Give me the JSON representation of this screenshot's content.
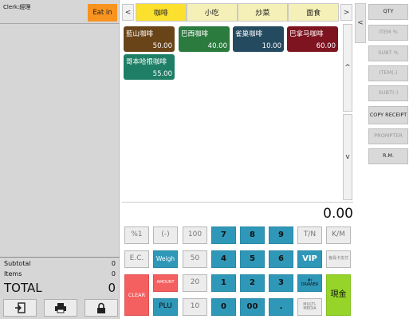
{
  "receipt": {
    "clerk_text": "Clerk:經理",
    "eat_in_label": "Eat in",
    "subtotal_label": "Subtotal",
    "subtotal_value": "0",
    "items_label": "Items",
    "items_value": "0",
    "total_label": "TOTAL",
    "total_value": "0"
  },
  "bottom_buttons": [
    {
      "icon": "logout-icon"
    },
    {
      "icon": "printer-icon"
    },
    {
      "icon": "lock-icon"
    }
  ],
  "categories": {
    "prev_label": "<",
    "next_label": ">",
    "items": [
      "咖啡",
      "小吃",
      "炒菜",
      "面食"
    ],
    "active_index": 0
  },
  "products": [
    {
      "name": "藍山咖啡",
      "price": "50.00",
      "color": "#6a4419"
    },
    {
      "name": "巴西咖啡",
      "price": "40.00",
      "color": "#2b7a3e"
    },
    {
      "name": "雀巢咖啡",
      "price": "10.00",
      "color": "#244a5f"
    },
    {
      "name": "巴拿马咖啡",
      "price": "60.00",
      "color": "#7d1420"
    },
    {
      "name": "哥本哈根咖啡",
      "price": "55.00",
      "color": "#1f7f66"
    }
  ],
  "scroll": {
    "up_label": "^",
    "down_label": "v",
    "side_label": "<"
  },
  "functions": [
    "QTY",
    "ITEM %",
    "SUBT %",
    "ITEM(-)",
    "SUBT(-)",
    "COPY RECEIPT",
    "PROMPTER",
    "R.M."
  ],
  "amount_display": "0.00",
  "keypad": {
    "pct1": "%1",
    "minus": "(-)",
    "k100": "100",
    "k7": "7",
    "k8": "8",
    "k9": "9",
    "tn": "T/N",
    "km": "K/M",
    "ec": "E.C.",
    "weigh": "Weigh",
    "k50": "50",
    "k4": "4",
    "k5": "5",
    "k6": "6",
    "vip": "VIP",
    "member": "會員卡支付",
    "clear": "CLEAR",
    "amount": "AMOUNT",
    "k20": "20",
    "k1": "1",
    "k2": "2",
    "k3": "3",
    "drawer": "#/ DRAWER",
    "cash": "現金",
    "plu": "PLU",
    "k10": "10",
    "k0": "0",
    "k00": "00",
    "dot": ".",
    "multimedia": "MULTI-MEDIA"
  }
}
